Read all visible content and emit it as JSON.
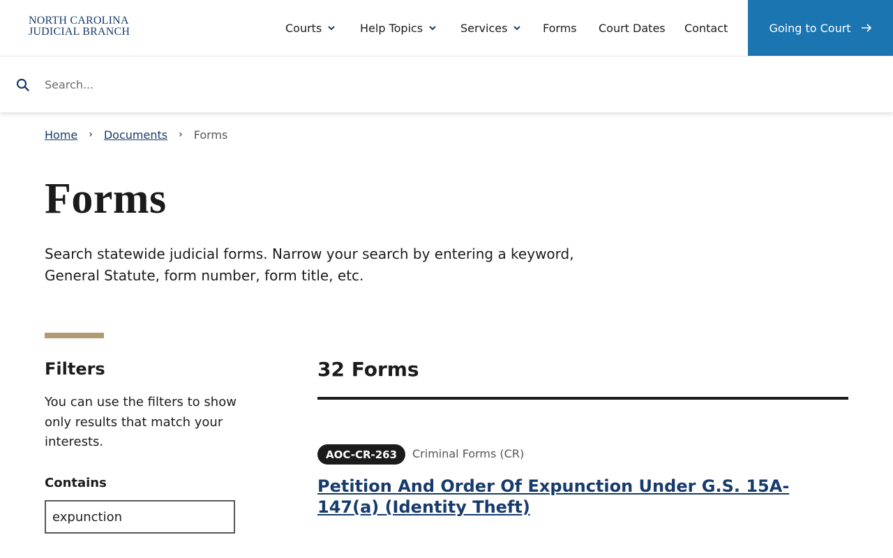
{
  "header": {
    "logo_line1": "NORTH CAROLINA",
    "logo_line2": "JUDICIAL BRANCH",
    "nav": [
      {
        "label": "Courts",
        "has_dropdown": true
      },
      {
        "label": "Help Topics",
        "has_dropdown": true
      },
      {
        "label": "Services",
        "has_dropdown": true
      },
      {
        "label": "Forms",
        "has_dropdown": false
      },
      {
        "label": "Court Dates",
        "has_dropdown": false
      },
      {
        "label": "Contact",
        "has_dropdown": false
      }
    ],
    "cta_label": "Going to Court",
    "cta_color": "#1b75b0"
  },
  "search": {
    "placeholder": "Search...",
    "value": ""
  },
  "breadcrumb": {
    "home": "Home",
    "documents": "Documents",
    "current": "Forms"
  },
  "page": {
    "title": "Forms",
    "intro": "Search statewide judicial forms. Narrow your search by entering a keyword, General Statute, form number, form title, etc.",
    "accent_color": "#b19b73"
  },
  "filters": {
    "title": "Filters",
    "description": "You can use the filters to show only results that match your interests.",
    "contains_label": "Contains",
    "contains_value": "expunction"
  },
  "results": {
    "count_label": "32 Forms",
    "items": [
      {
        "form_number": "AOC-CR-263",
        "category": "Criminal Forms (CR)",
        "title": "Petition And Order Of Expunction Under G.S. 15A-147(a) (Identity Theft)"
      }
    ]
  },
  "icons": {
    "search": "search-icon",
    "chevron": "chevron-down-icon",
    "arrow": "arrow-right-icon"
  }
}
